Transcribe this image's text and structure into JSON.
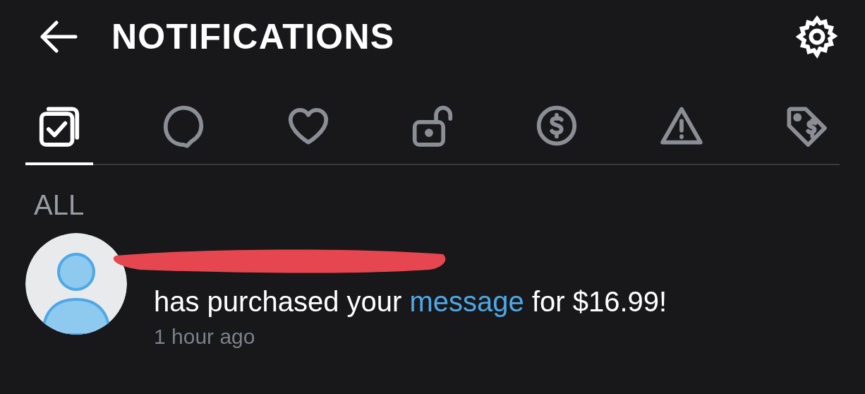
{
  "header": {
    "title": "NOTIFICATIONS"
  },
  "tabs": [
    {
      "kind": "all",
      "selected": true
    },
    {
      "kind": "comments",
      "selected": false
    },
    {
      "kind": "likes",
      "selected": false
    },
    {
      "kind": "subscriptions",
      "selected": false
    },
    {
      "kind": "tips",
      "selected": false
    },
    {
      "kind": "alerts",
      "selected": false
    },
    {
      "kind": "promotions",
      "selected": false
    }
  ],
  "section": {
    "title": "ALL"
  },
  "notifications": [
    {
      "redacted": true,
      "text_before": "has purchased your ",
      "link": "message",
      "text_after": " for $16.99!",
      "time": "1 hour ago"
    }
  ]
}
